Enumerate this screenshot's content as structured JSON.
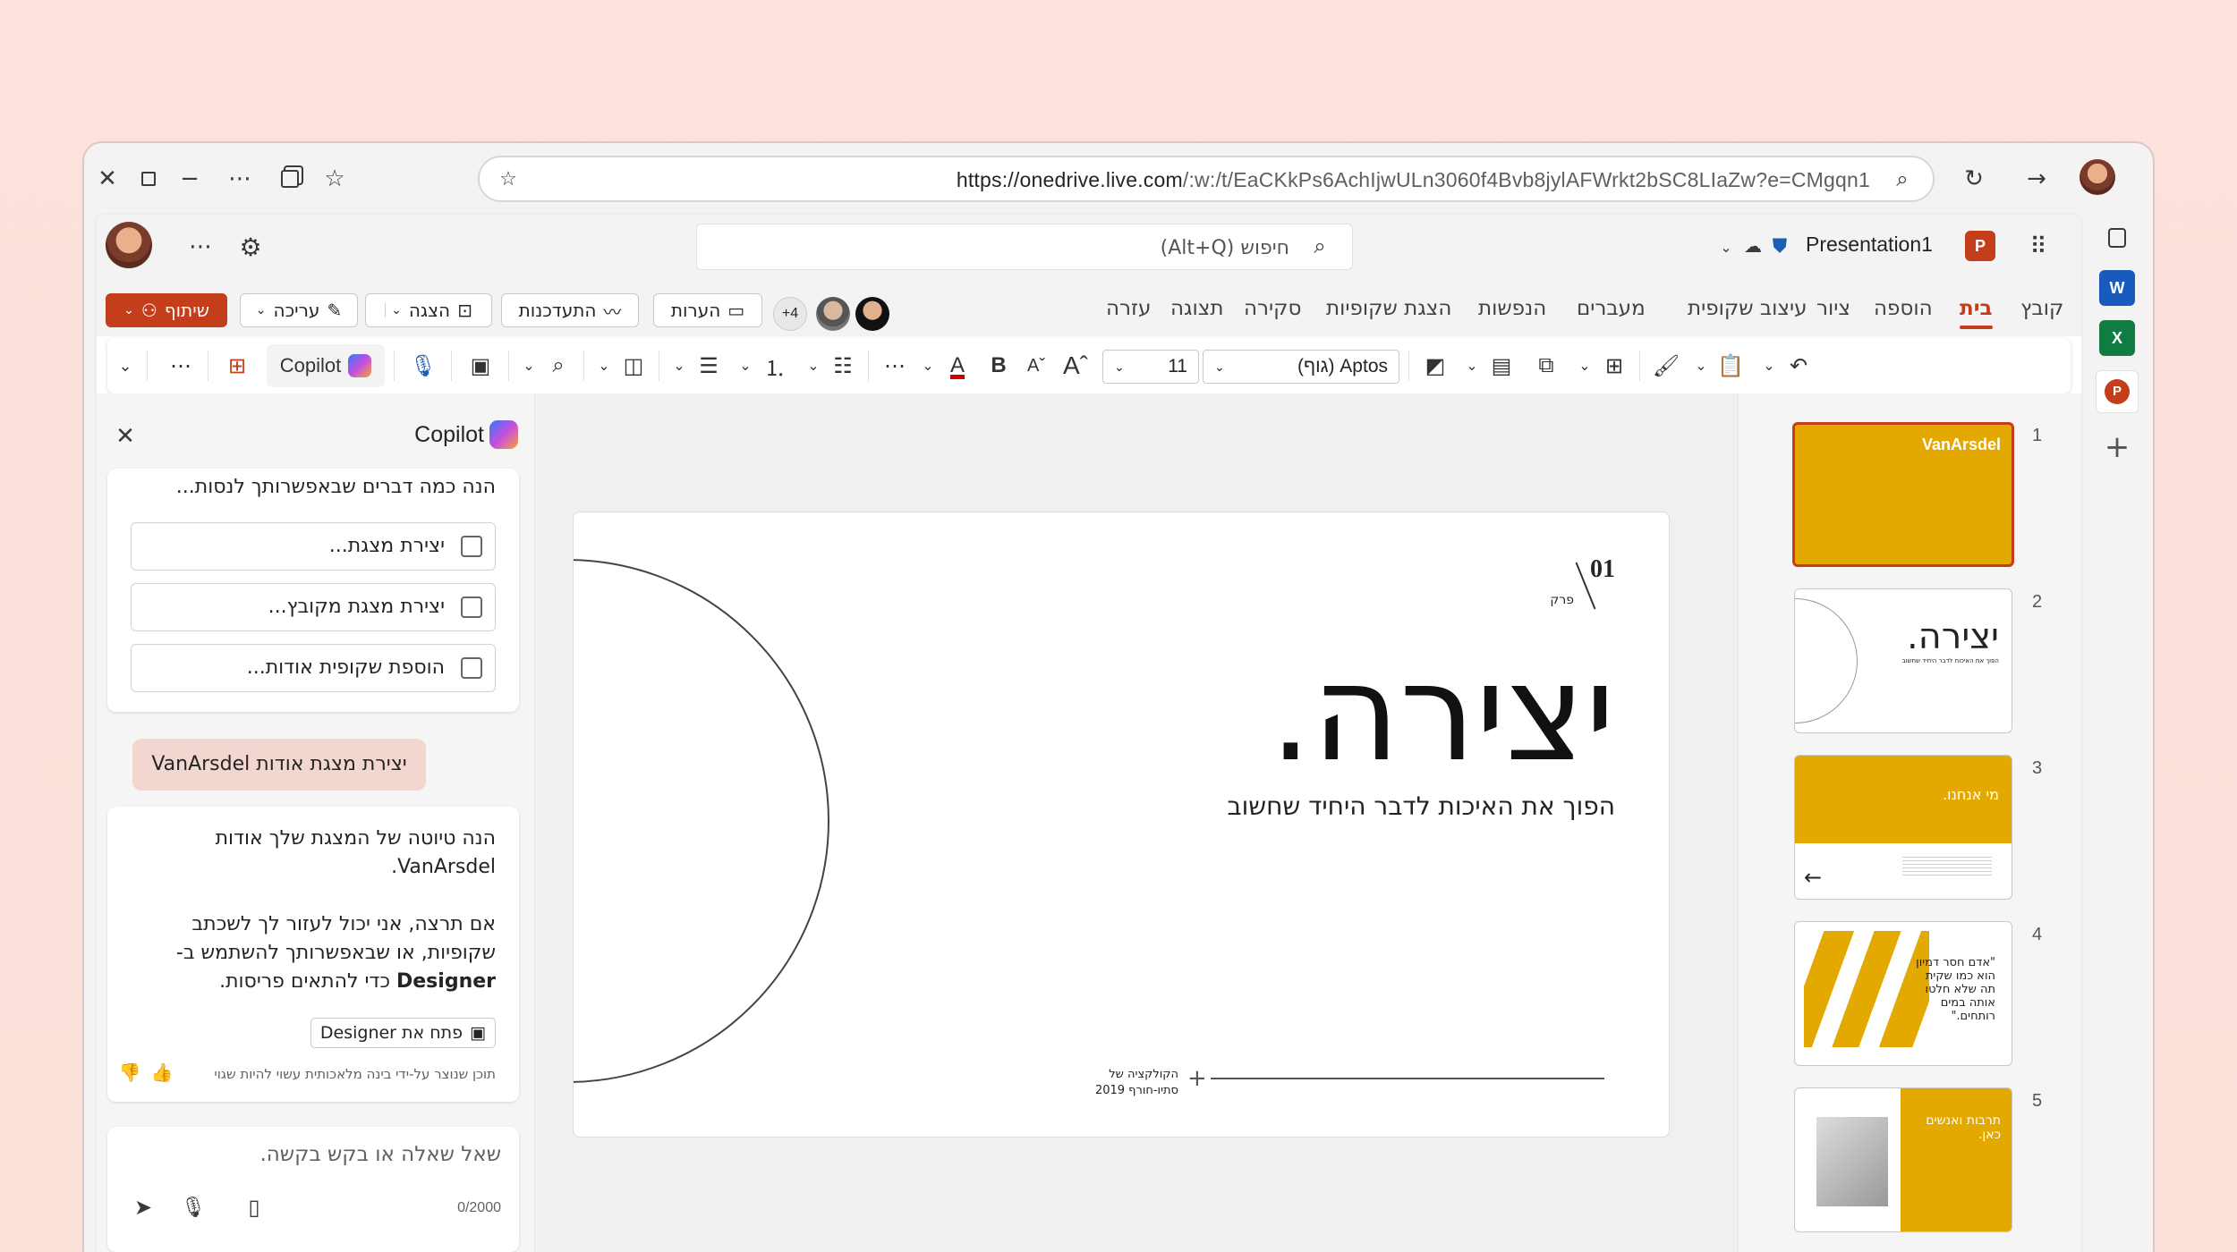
{
  "browser": {
    "url_host": "https://onedrive.live.com",
    "url_path": "/:w:/t/EaCKkPs6AchIjwULn3060f4Bvb8jylAFWrkt2bSC8LIaZw?e=CMgqn1"
  },
  "app": {
    "search_placeholder": "חיפוש (Alt+Q)",
    "presentation_name": "Presentation1",
    "ribbon_tabs": [
      "קובץ",
      "בית",
      "הוספה",
      "ציור",
      "עיצוב שקופית",
      "מעברים",
      "הנפשות",
      "הצגת שקופיות",
      "סקירה",
      "תצוגה",
      "עזרה"
    ],
    "share_label": "שיתוף",
    "edit_label": "עריכה",
    "present_label": "הצגה",
    "catchup_label": "התעדכנות",
    "comments_label": "הערות",
    "collaborators_more": "+4",
    "font_name": "Aptos (גוף)",
    "font_size": "11",
    "copilot_button": "Copilot"
  },
  "copilot": {
    "title": "Copilot",
    "intro": "הנה כמה דברים שבאפשרותך לנסות...",
    "suggestions": [
      "יצירת מצגת...",
      "יצירת מצגת מקובץ...",
      "הוספת שקופית אודות..."
    ],
    "user_message": "יצירת מצגת אודות VanArsdel",
    "reply_line1": "הנה טיוטה של המצגת שלך אודות",
    "reply_line2": "VanArsdel.",
    "reply_line3": "אם תרצה, אני יכול לעזור לך לשכתב",
    "reply_line4": "שקופיות, או שבאפשרותך להשתמש ב-",
    "reply_line5_bold": "Designer",
    "reply_line5_rest": " כדי להתאים פריסות.",
    "open_designer": "פתח את Designer",
    "disclaimer": "תוכן שנוצר על-ידי בינה מלאכותית עשוי להיות שגוי",
    "input_placeholder": "שאל שאלה או בקש בקשה.",
    "char_count": "0/2000"
  },
  "slide": {
    "number": "01",
    "section": "פרק",
    "title": "יצירה.",
    "subtitle": "הפוך את האיכות לדבר היחיד שחשוב",
    "footer_line1": "הקולקציה של",
    "footer_line2": "סתיו-חורף 2019"
  },
  "thumbnails": {
    "numbers": [
      "1",
      "2",
      "3",
      "4",
      "5"
    ],
    "t1_brand": "VanArsdel",
    "t2_title": "יצירה.",
    "t2_sub": "הפוך את האיכות לדבר היחיד שחשוב",
    "t3_title": "מי אנחנו.",
    "t4_quote": "\"אדם חסר דמיון הוא כמו שקית תה שלא חלטו אותה במים רותחים.\"",
    "t5_title": "תרבות ואנשים כאן."
  },
  "colors": {
    "accent": "#c43e1c",
    "gold": "#e3a900",
    "background": "#fde2dd"
  }
}
